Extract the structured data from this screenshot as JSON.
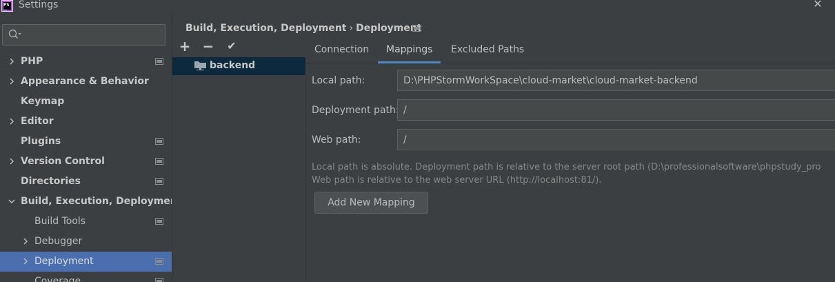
{
  "window": {
    "app_icon_text": "PS",
    "title": "Settings",
    "close_glyph": "✕"
  },
  "search": {
    "placeholder": "",
    "value": "",
    "icon": "search-icon"
  },
  "sidebar": {
    "items": [
      {
        "label": "PHP",
        "chevron": "right",
        "bold": true
      },
      {
        "label": "Appearance & Behavior",
        "chevron": "right",
        "bold": true
      },
      {
        "label": "Keymap",
        "chevron": "",
        "bold": true
      },
      {
        "label": "Editor",
        "chevron": "right",
        "bold": true
      },
      {
        "label": "Plugins",
        "chevron": "",
        "bold": true
      },
      {
        "label": "Version Control",
        "chevron": "right",
        "bold": true
      },
      {
        "label": "Directories",
        "chevron": "",
        "bold": true
      },
      {
        "label": "Build, Execution, Deployment",
        "chevron": "down",
        "bold": true
      },
      {
        "label": "Build Tools",
        "chevron": "",
        "bold": false
      },
      {
        "label": "Debugger",
        "chevron": "right",
        "bold": false
      },
      {
        "label": "Deployment",
        "chevron": "right",
        "bold": false,
        "selected": true
      },
      {
        "label": "Coverage",
        "chevron": "",
        "bold": false
      }
    ]
  },
  "breadcrumb": {
    "parent": "Build, Execution, Deployment",
    "separator": "›",
    "current": "Deployment"
  },
  "toolbar": {
    "add": "+",
    "remove": "−",
    "apply": "✔"
  },
  "servers": [
    {
      "label": "backend"
    }
  ],
  "tabs": [
    {
      "label": "Connection"
    },
    {
      "label": "Mappings",
      "active": true
    },
    {
      "label": "Excluded Paths"
    }
  ],
  "mappings": {
    "local_path_label": "Local path:",
    "local_path_value": "D:\\PHPStormWorkSpace\\cloud-market\\cloud-market-backend",
    "deployment_path_label": "Deployment path:",
    "deployment_path_value": "/",
    "web_path_label": "Web path:",
    "web_path_value": "/",
    "help_line_1": "Local path is absolute. Deployment path is relative to the server root path (D:\\professionalsoftware\\phpstudy_pro",
    "help_line_2": "Web path is relative to the web server URL (http://localhost:81/).",
    "add_button": "Add New Mapping"
  },
  "colors": {
    "background": "#3c3f41",
    "selection": "#4b6eaf",
    "server_selection": "#0d293e",
    "tab_underline": "#4a88c7"
  }
}
